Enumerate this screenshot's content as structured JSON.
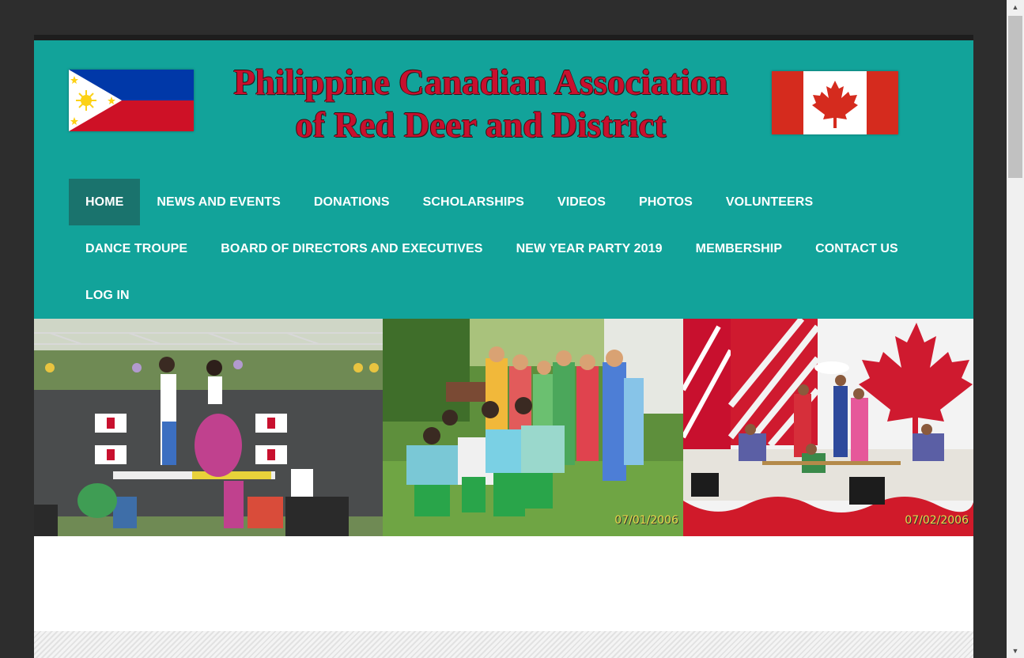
{
  "site": {
    "title_line1": "Philippine Canadian Association",
    "title_line2": "of Red Deer and District",
    "colors": {
      "header_bg": "#12a39a",
      "nav_active_bg": "#1a736d",
      "title_red": "#c8102e"
    }
  },
  "nav": {
    "row1": [
      "HOME",
      "NEWS AND EVENTS",
      "DONATIONS",
      "SCHOLARSHIPS",
      "VIDEOS",
      "PHOTOS",
      "VOLUNTEERS"
    ],
    "row2": [
      "DANCE TROUPE",
      "BOARD OF DIRECTORS AND EXECUTIVES",
      "NEW YEAR PARTY 2019",
      "MEMBERSHIP",
      "CONTACT US"
    ],
    "row3": [
      "LOG IN"
    ],
    "active": "HOME"
  },
  "banner": {
    "photo2_date": "07/01/2006",
    "photo3_date": "07/02/2006"
  },
  "icons": {
    "scroll_up": "scroll-up-arrow-icon",
    "scroll_down": "scroll-down-arrow-icon"
  }
}
